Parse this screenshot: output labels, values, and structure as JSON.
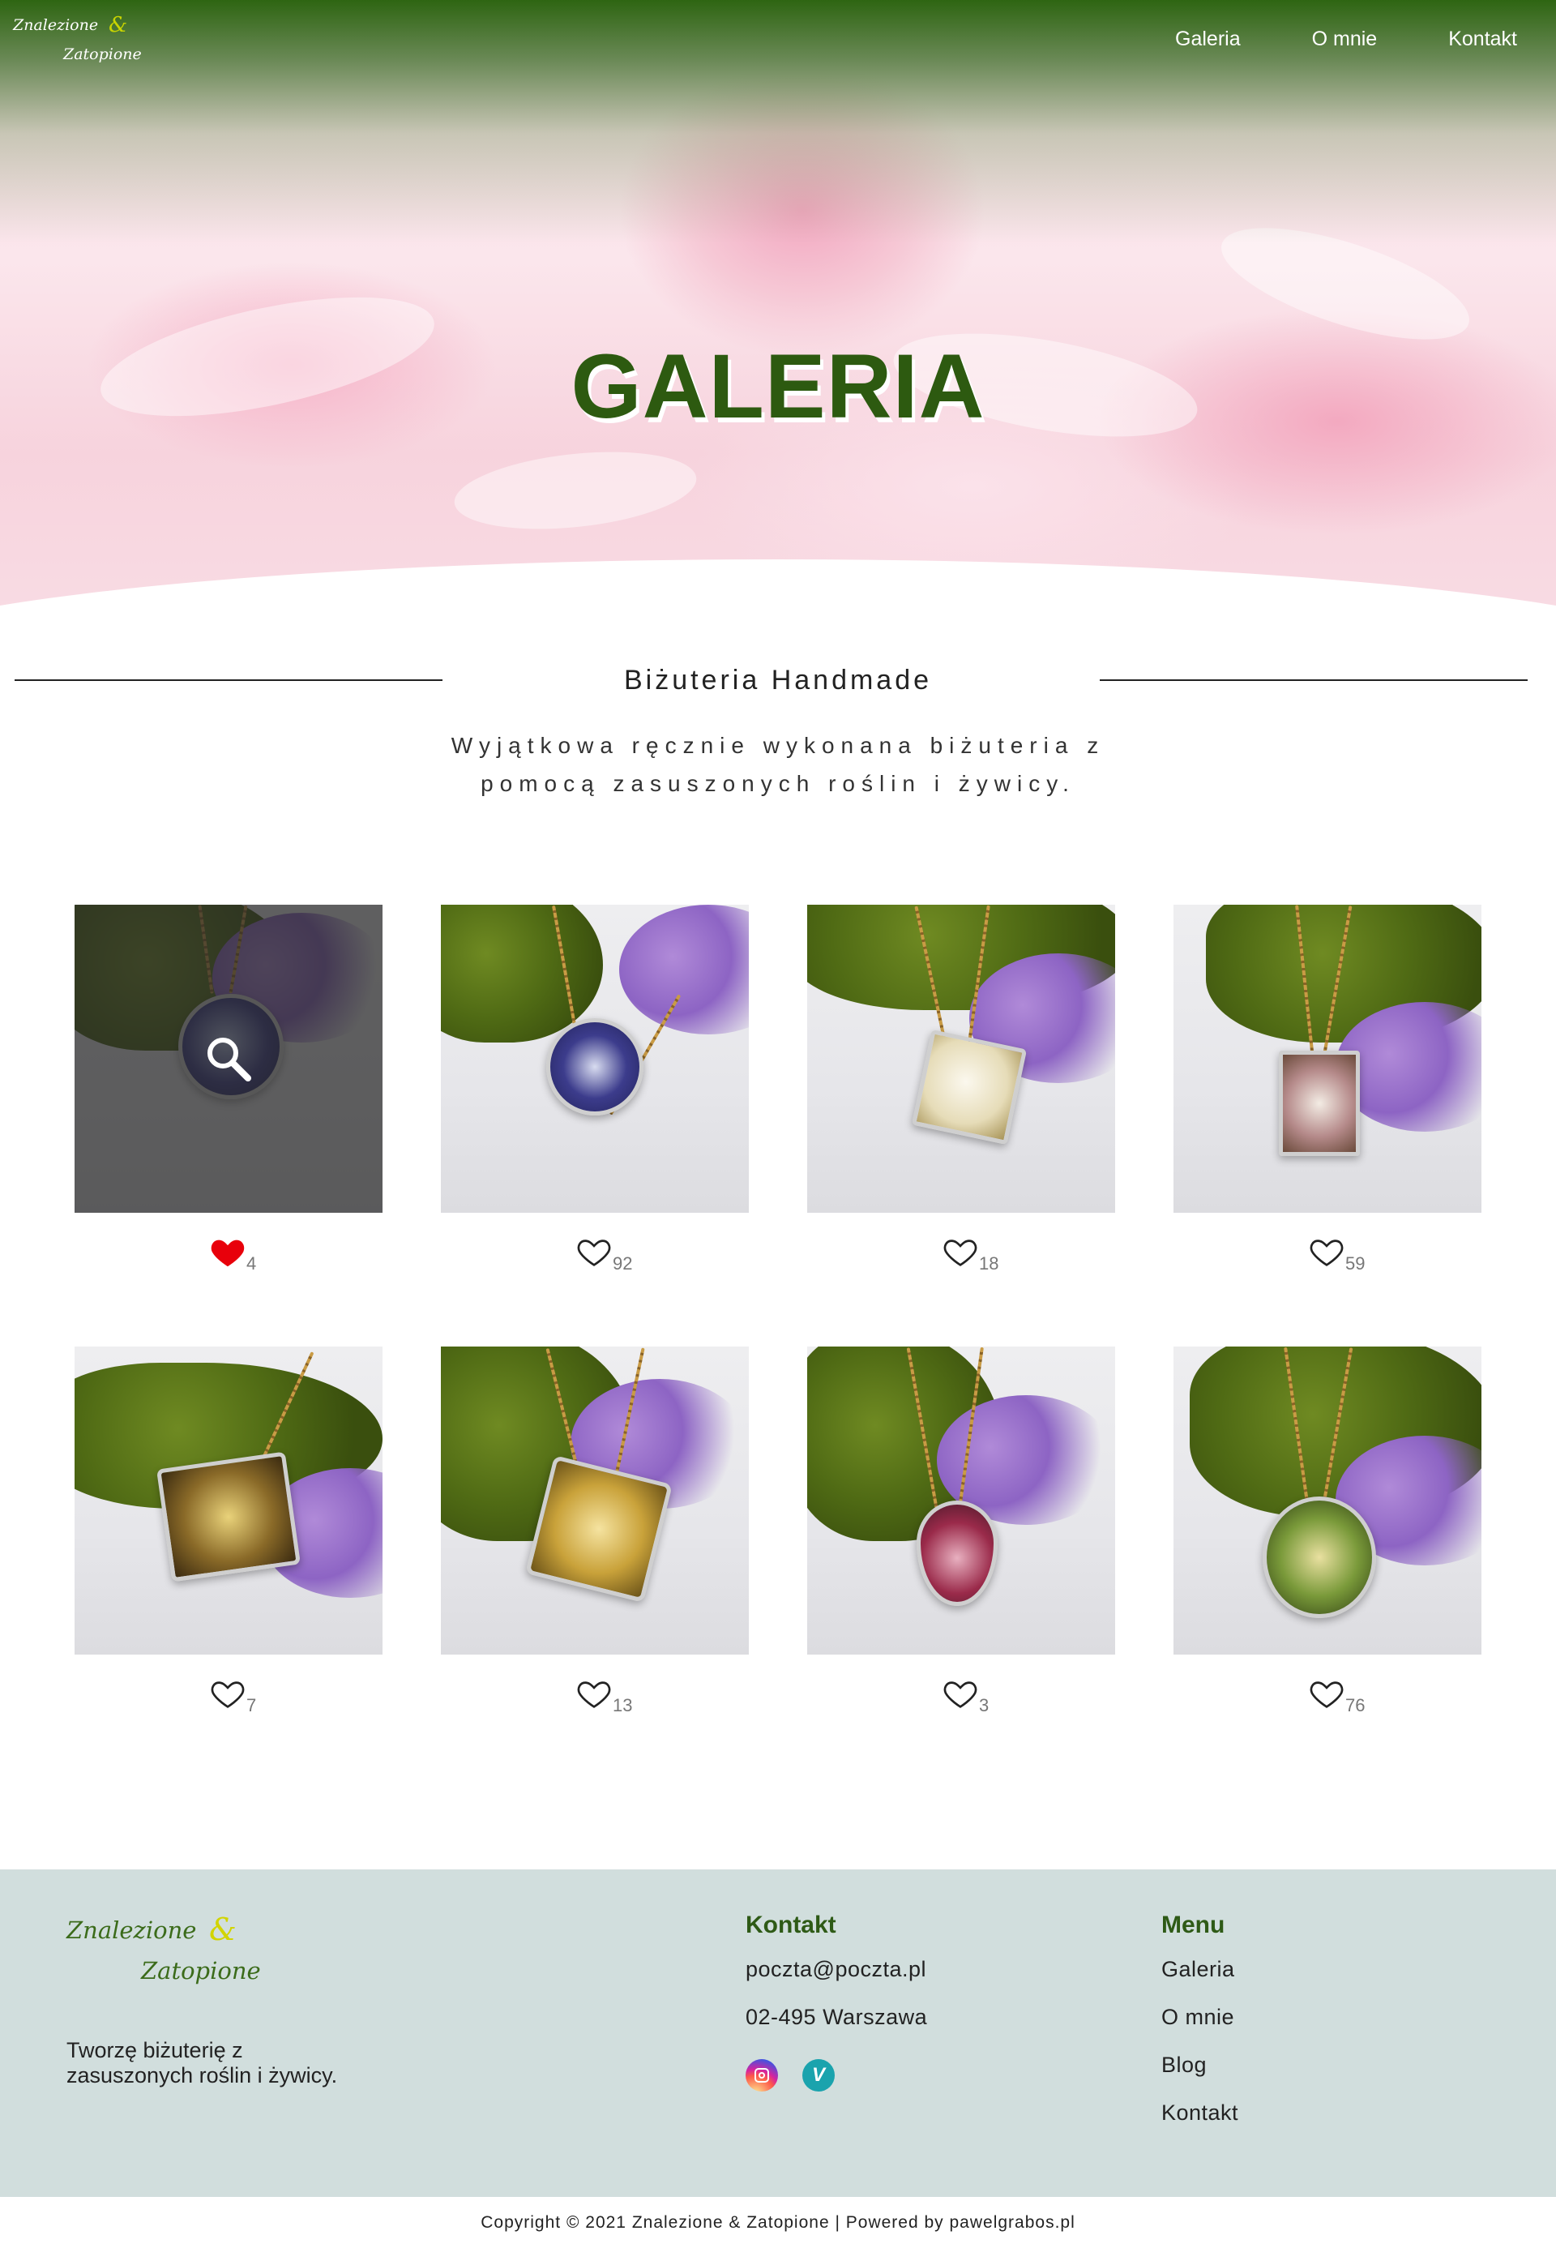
{
  "header": {
    "logo": {
      "line1": "Znalezione",
      "amp": "&",
      "line2": "Zatopione"
    },
    "nav": [
      "Galeria",
      "O mnie",
      "Kontakt"
    ]
  },
  "hero": {
    "title": "GALERIA"
  },
  "intro": {
    "heading": "Biżuteria Handmade",
    "text": "Wyjątkowa ręcznie wykonana biżuteria z pomocą zasuszonych roślin i żywicy."
  },
  "gallery": [
    {
      "likes": "4",
      "liked": true,
      "hover": true
    },
    {
      "likes": "92",
      "liked": false
    },
    {
      "likes": "18",
      "liked": false
    },
    {
      "likes": "59",
      "liked": false
    },
    {
      "likes": "7",
      "liked": false
    },
    {
      "likes": "13",
      "liked": false
    },
    {
      "likes": "3",
      "liked": false
    },
    {
      "likes": "76",
      "liked": false
    }
  ],
  "footer": {
    "logo": {
      "line1": "Znalezione",
      "amp": "&",
      "line2": "Zatopione"
    },
    "description": "Tworzę biżuterię z zasuszonych roślin i żywicy.",
    "contact": {
      "heading": "Kontakt",
      "email": "poczta@poczta.pl",
      "address": "02-495 Warszawa"
    },
    "social": [
      {
        "icon": "instagram-icon"
      },
      {
        "icon": "vinted-icon",
        "letter": "V"
      }
    ],
    "menu": {
      "heading": "Menu",
      "items": [
        "Galeria",
        "O mnie",
        "Blog",
        "Kontakt"
      ]
    }
  },
  "copyright": "Copyright © 2021 Znalezione & Zatopione | Powered by pawelgrabos.pl",
  "colors": {
    "brand_green": "#2e5a16",
    "liked_heart": "#e8000b",
    "footer_bg": "#d1dedd"
  }
}
